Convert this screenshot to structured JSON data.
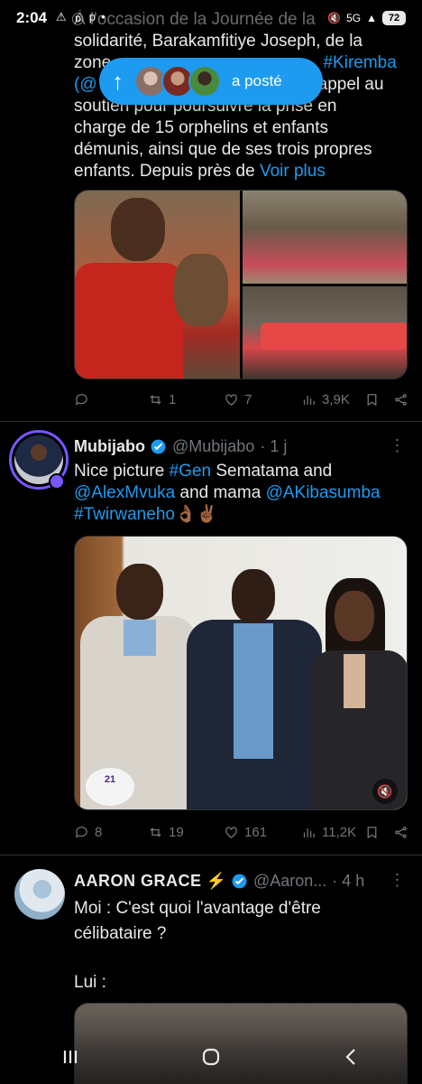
{
  "status_bar": {
    "time": "2:04",
    "left_icons": [
      "⚠",
      "Ⓓ",
      "p",
      "•"
    ],
    "network": "5G",
    "battery": "72"
  },
  "tweet1": {
    "text_line1": "À l'occasion de la Journée de la",
    "text_line2": "solidarité, Barakamfitiye Joseph, de la",
    "text_line3_start": "zone",
    "text_line3_link": "#Kiremba",
    "text_line4_start": "(@",
    "text_line4_end": "appel au",
    "text_line5": "soutien pour poursuivre la prise en",
    "text_line6": "charge de 15 orphelins et enfants",
    "text_line7": "démunis, ainsi que de ses trois propres",
    "text_line8_start": "enfants. Depuis près de",
    "see_more": "Voir plus",
    "replies": "",
    "retweets": "1",
    "likes": "7",
    "views": "3,9K"
  },
  "posted_pill": {
    "label": "a posté"
  },
  "tweet2": {
    "name": "Mubijabo",
    "handle": "@Mubijabo",
    "time": "· 1 j",
    "text_part1": "Nice picture",
    "hashtag1": "#Gen",
    "text_part2": "Sematama and",
    "mention1": "@AlexMvuka",
    "text_part3": "and mama",
    "mention2": "@AKibasumba",
    "hashtag2": "#Twirwaneho",
    "emoji": "👌🏾✌🏾",
    "photo_logo": "21",
    "replies": "8",
    "retweets": "19",
    "likes": "161",
    "views": "11,2K"
  },
  "tweet3": {
    "name": "AARON GRACE",
    "bolt": "⚡",
    "handle": "@Aaron...",
    "time": "· 4 h",
    "line1": "Moi : C'est quoi l'avantage d'être",
    "line2": "célibataire ?",
    "line3": "Lui :"
  },
  "nav_bar": {
    "recents": "|||",
    "home": "○",
    "back": "<"
  },
  "colors": {
    "accent": "#1d9bf0",
    "background": "#000000",
    "text": "#e7e9ea",
    "muted": "#71767b"
  }
}
